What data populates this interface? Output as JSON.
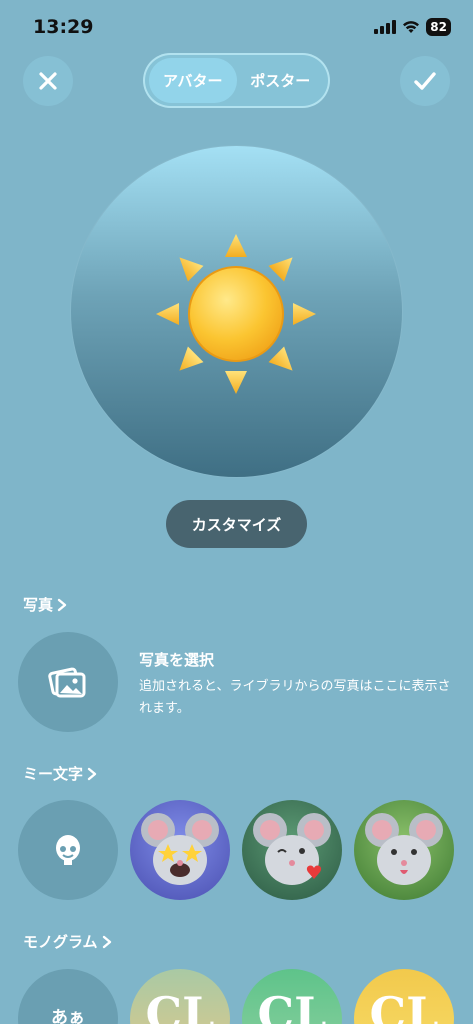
{
  "status": {
    "time": "13:29",
    "battery": "82"
  },
  "nav": {
    "tabs": [
      {
        "label": "アバター",
        "active": true
      },
      {
        "label": "ポスター",
        "active": false
      }
    ]
  },
  "customize_label": "カスタマイズ",
  "photos": {
    "header": "写真",
    "select_title": "写真を選択",
    "select_desc": "追加されると、ライブラリからの写真はここに表示されます。"
  },
  "memoji": {
    "header": "ミー文字"
  },
  "monogram": {
    "header": "モノグラム",
    "items": [
      {
        "text": "あぁ"
      },
      {
        "text": "CL"
      },
      {
        "text": "CL"
      },
      {
        "text": "CL"
      }
    ]
  },
  "colors": {
    "background": "#7fb5c9",
    "accent": "#92d4ea",
    "customize_bg": "#48646f"
  }
}
